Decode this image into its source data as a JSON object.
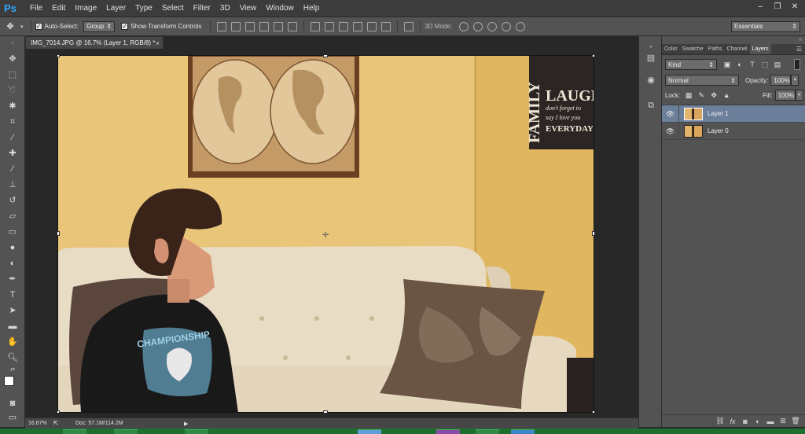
{
  "app": {
    "logo": "Ps",
    "brand_color": "#31a8ff"
  },
  "menu": [
    "File",
    "Edit",
    "Image",
    "Layer",
    "Type",
    "Select",
    "Filter",
    "3D",
    "View",
    "Window",
    "Help"
  ],
  "window_controls": {
    "minimize": "–",
    "restore": "❐",
    "close": "✕"
  },
  "options": {
    "auto_select_label": "Auto-Select:",
    "auto_select_value": "Group",
    "show_transform_label": "Show Transform Controls",
    "mode_3d_label": "3D Mode:",
    "workspace": "Essentials"
  },
  "document": {
    "tab_title": "IMG_7014.JPG @ 16.7% (Layer 1, RGB/8) *",
    "tab_close": "×"
  },
  "status": {
    "zoom": "16.67%",
    "doc_size": "Doc: 57.1M/114.2M"
  },
  "photo": {
    "poster_lines": [
      "FAMILY",
      "LAUGH",
      "don't forget to",
      "say I love you",
      "EVERYDAY"
    ],
    "shirt_text": "CHAMPIONSHIP"
  },
  "panels": {
    "tabs": [
      "Color",
      "Swatche",
      "Paths",
      "Channel",
      "Layers"
    ],
    "active_tab": "Layers",
    "kind_label": "Kind",
    "blend_mode": "Normal",
    "opacity_label": "Opacity:",
    "opacity_value": "100%",
    "lock_label": "Lock:",
    "fill_label": "Fill:",
    "fill_value": "100%",
    "layers": [
      {
        "name": "Layer 1",
        "selected": true,
        "visible": true
      },
      {
        "name": "Layer 0",
        "selected": false,
        "visible": true
      }
    ],
    "footer_icons": [
      "link-icon",
      "fx-icon",
      "mask-icon",
      "adjustment-icon",
      "folder-icon",
      "new-layer-icon",
      "trash-icon"
    ]
  },
  "colors": {
    "ui_dark": "#282828",
    "ui_mid": "#535353",
    "selected_layer": "#6b7f9b",
    "wall": "#e8c67a"
  }
}
